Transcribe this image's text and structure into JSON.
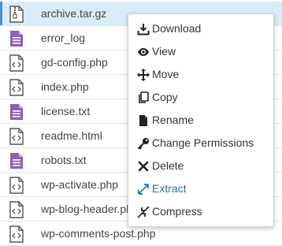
{
  "files": [
    {
      "name": "archive.tar.gz",
      "icon": "archive-file-icon",
      "selected": true
    },
    {
      "name": "error_log",
      "icon": "text-file-icon",
      "selected": false
    },
    {
      "name": "gd-config.php",
      "icon": "code-file-icon",
      "selected": false
    },
    {
      "name": "index.php",
      "icon": "code-file-icon",
      "selected": false
    },
    {
      "name": "license.txt",
      "icon": "text-file-icon",
      "selected": false
    },
    {
      "name": "readme.html",
      "icon": "code-file-icon",
      "selected": false
    },
    {
      "name": "robots.txt",
      "icon": "text-file-icon",
      "selected": false
    },
    {
      "name": "wp-activate.php",
      "icon": "code-file-icon",
      "selected": false
    },
    {
      "name": "wp-blog-header.php",
      "icon": "code-file-icon",
      "selected": false
    },
    {
      "name": "wp-comments-post.php",
      "icon": "code-file-icon",
      "selected": false
    }
  ],
  "context_menu": {
    "items": [
      {
        "label": "Download",
        "icon": "download-icon"
      },
      {
        "label": "View",
        "icon": "eye-icon"
      },
      {
        "label": "Move",
        "icon": "move-arrows-icon"
      },
      {
        "label": "Copy",
        "icon": "copy-icon"
      },
      {
        "label": "Rename",
        "icon": "rename-file-icon"
      },
      {
        "label": "Change Permissions",
        "icon": "key-icon"
      },
      {
        "label": "Delete",
        "icon": "delete-x-icon"
      },
      {
        "label": "Extract",
        "icon": "extract-arrows-icon"
      },
      {
        "label": "Compress",
        "icon": "compress-arrows-icon"
      }
    ]
  },
  "colors": {
    "selected_row": "#d9ecf7",
    "text_file_icon": "#8e5fb5",
    "accent": "#2f6fa3"
  }
}
